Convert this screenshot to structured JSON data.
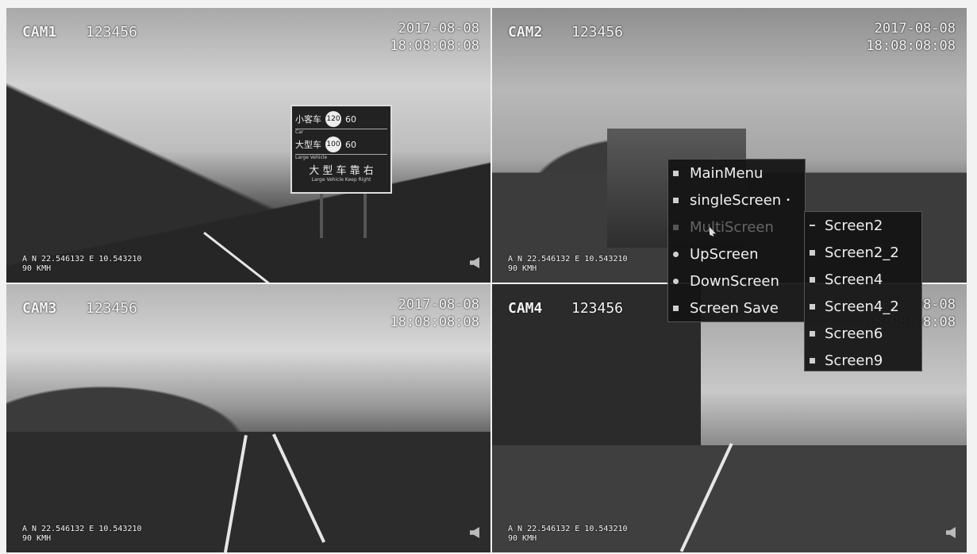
{
  "cameras": [
    {
      "id": "CAM1",
      "code": "123456",
      "date": "2017-08-08",
      "time": "18:08:08:08",
      "gps": "A N 22.546132  E 10.543210",
      "speed": "90 KMH"
    },
    {
      "id": "CAM2",
      "code": "123456",
      "date": "2017-08-08",
      "time": "18:08:08:08",
      "gps": "A N 22.546132  E 10.543210",
      "speed": "90 KMH"
    },
    {
      "id": "CAM3",
      "code": "123456",
      "date": "2017-08-08",
      "time": "18:08:08:08",
      "gps": "A N 22.546132  E 10.543210",
      "speed": "90 KMH"
    },
    {
      "id": "CAM4",
      "code": "123456",
      "date": "2017-08-08",
      "time": "18:08:08:08",
      "gps": "A N 22.546132  E 10.543210",
      "speed": "90 KMH"
    }
  ],
  "road_sign": {
    "rows": [
      {
        "cn": "小客车",
        "en": "Car",
        "max": "120",
        "min": "60"
      },
      {
        "cn": "大型车",
        "en": "Large Vehicle",
        "max": "100",
        "min": "60"
      }
    ],
    "bottom_cn": "大 型 车 靠 右",
    "bottom_en": "Large Vehicle Keep Right"
  },
  "main_menu": {
    "items": [
      {
        "label": "MainMenu",
        "icon": "menu-icon"
      },
      {
        "label": "singleScreen",
        "icon": "single-screen-icon",
        "has_submenu": true
      },
      {
        "label": "MultiScreen",
        "icon": "multi-screen-icon",
        "disabled": true
      },
      {
        "label": "UpScreen",
        "icon": "up-icon"
      },
      {
        "label": "DownScreen",
        "icon": "down-icon"
      },
      {
        "label": "Screen Save",
        "icon": "save-icon"
      }
    ]
  },
  "sub_menu": {
    "items": [
      {
        "label": "Screen2",
        "icon": "layout-2-icon"
      },
      {
        "label": "Screen2_2",
        "icon": "layout-2-2-icon"
      },
      {
        "label": "Screen4",
        "icon": "layout-4-icon"
      },
      {
        "label": "Screen4_2",
        "icon": "layout-4-2-icon"
      },
      {
        "label": "Screen6",
        "icon": "layout-6-icon"
      },
      {
        "label": "Screen9",
        "icon": "layout-9-icon"
      }
    ]
  }
}
